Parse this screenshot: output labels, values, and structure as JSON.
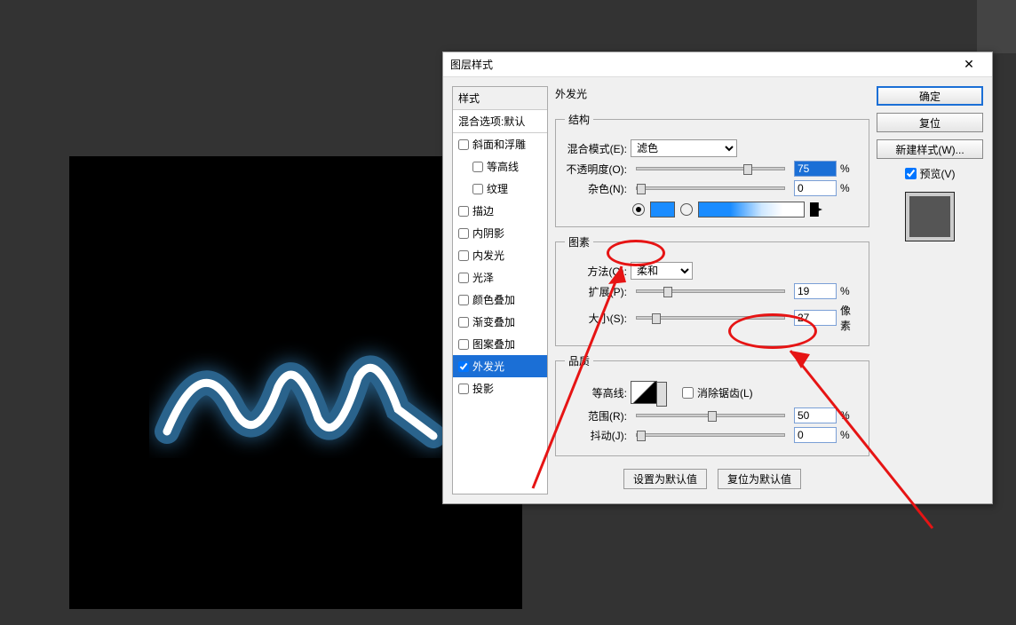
{
  "dialog_title": "图层样式",
  "styles_panel": {
    "header": "样式",
    "blend_options": "混合选项:默认",
    "items": [
      {
        "label": "斜面和浮雕",
        "checked": false,
        "indent": false
      },
      {
        "label": "等高线",
        "checked": false,
        "indent": true
      },
      {
        "label": "纹理",
        "checked": false,
        "indent": true
      },
      {
        "label": "描边",
        "checked": false,
        "indent": false
      },
      {
        "label": "内阴影",
        "checked": false,
        "indent": false
      },
      {
        "label": "内发光",
        "checked": false,
        "indent": false
      },
      {
        "label": "光泽",
        "checked": false,
        "indent": false
      },
      {
        "label": "颜色叠加",
        "checked": false,
        "indent": false
      },
      {
        "label": "渐变叠加",
        "checked": false,
        "indent": false
      },
      {
        "label": "图案叠加",
        "checked": false,
        "indent": false
      },
      {
        "label": "外发光",
        "checked": true,
        "indent": false,
        "active": true
      },
      {
        "label": "投影",
        "checked": false,
        "indent": false
      }
    ]
  },
  "outer_glow": {
    "title": "外发光",
    "structure": {
      "legend": "结构",
      "blend_mode_label": "混合模式(E):",
      "blend_mode_value": "滤色",
      "opacity_label": "不透明度(O):",
      "opacity_value": "75",
      "opacity_unit": "%",
      "noise_label": "杂色(N):",
      "noise_value": "0",
      "noise_unit": "%",
      "color_hex": "#1a8cff"
    },
    "elements": {
      "legend": "图素",
      "technique_label": "方法(Q):",
      "technique_value": "柔和",
      "spread_label": "扩展(P):",
      "spread_value": "19",
      "spread_unit": "%",
      "size_label": "大小(S):",
      "size_value": "27",
      "size_unit": "像素"
    },
    "quality": {
      "legend": "品质",
      "contour_label": "等高线:",
      "antialias_label": "消除锯齿(L)",
      "range_label": "范围(R):",
      "range_value": "50",
      "range_unit": "%",
      "jitter_label": "抖动(J):",
      "jitter_value": "0",
      "jitter_unit": "%"
    },
    "defaults": {
      "make_default": "设置为默认值",
      "reset_default": "复位为默认值"
    }
  },
  "buttons": {
    "ok": "确定",
    "cancel": "复位",
    "new_style": "新建样式(W)...",
    "preview": "预览(V)"
  }
}
